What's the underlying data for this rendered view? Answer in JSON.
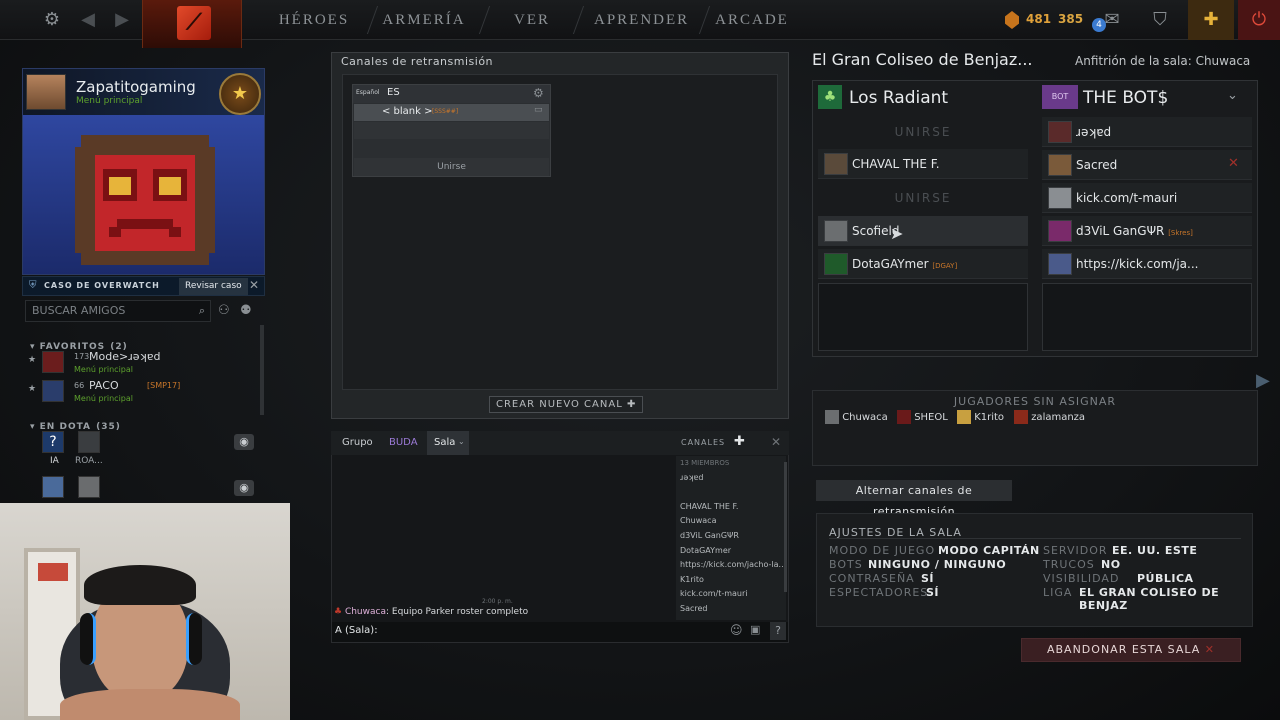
{
  "topbar": {
    "nav": [
      "HÉROES",
      "ARMERÍA",
      "VER",
      "APRENDER",
      "ARCADE"
    ],
    "currency_shards": "481",
    "currency_level": "385",
    "notifications": "4"
  },
  "profile": {
    "name": "Zapatitogaming",
    "status": "Menú principal"
  },
  "overwatch": {
    "label": "CASO DE OVERWATCH",
    "button": "Revisar caso"
  },
  "friends": {
    "search_placeholder": "BUSCAR AMIGOS",
    "favorites_header": "FAVORITOS",
    "favorites_count": "(2)",
    "favorites": [
      {
        "level": "173",
        "name": "Mode>ɹǝʞɐd",
        "tag": "",
        "status": "Menú principal"
      },
      {
        "level": "66",
        "name": "PACO",
        "tag": "[SMP17]",
        "status": "Menú principal"
      }
    ],
    "in_dota_header": "EN DOTA",
    "in_dota_count": "(35)",
    "in_dota": [
      {
        "name": "IA"
      },
      {
        "name": "ROA..."
      }
    ]
  },
  "broadcast": {
    "title": "Canales de retransmisión",
    "lang_small": "Español",
    "lang_code": "ES",
    "channel": "< blank >",
    "channel_tag": "[SSS##]",
    "join": "Unirse",
    "new_channel": "CREAR NUEVO CANAL"
  },
  "chat": {
    "tabs": [
      "Grupo",
      "BUDA",
      "Sala"
    ],
    "channels_label": "CANALES",
    "members_count": "13 MIEMBROS",
    "members": [
      "ɹǝʞɐd",
      "",
      "CHAVAL THE F.",
      "Chuwaca",
      "d3ViL GanGΨR",
      "DotaGAYmer",
      "https://kick.com/jacho-la...",
      "K1rito",
      "kick.com/t-mauri",
      "Sacred"
    ],
    "time": "2:00 p. m.",
    "message_author": "Chuwaca",
    "message_text": ": Equipo Parker roster completo",
    "input_prefix": "A (Sala):"
  },
  "lobby": {
    "title": "El Gran Coliseo de Benjaz...",
    "host": "Anfitrión de la sala: Chuwaca",
    "radiant": {
      "name": "Los Radiant",
      "join_label": "UNIRSE",
      "players": [
        "CHAVAL THE F.",
        "Scofield",
        "DotaGAYmer"
      ],
      "player_tag": "[DGAY]"
    },
    "dire": {
      "name": "THE BOT$",
      "players": [
        "ɹǝʞɐd",
        "Sacred",
        "kick.com/t-mauri",
        "d3ViL GanGΨR",
        "https://kick.com/ja..."
      ],
      "devil_tag": "[Skres]"
    },
    "unassigned_header": "JUGADORES SIN ASIGNAR",
    "unassigned": [
      "Chuwaca",
      "SHEOL",
      "K1rito",
      "zalamanza"
    ],
    "toggle_broadcast": "Alternar canales de retransmisión",
    "settings": {
      "header": "AJUSTES DE LA SALA",
      "mode_label": "MODO DE JUEGO",
      "mode_value": "MODO CAPITÁN",
      "bots_label": "BOTS",
      "bots_value": "NINGUNO / NINGUNO",
      "password_label": "CONTRASEÑA",
      "password_value": "SÍ",
      "spectators_label": "ESPECTADORES",
      "spectators_value": "SÍ",
      "server_label": "SERVIDOR",
      "server_value": "EE. UU. ESTE",
      "cheats_label": "TRUCOS",
      "cheats_value": "NO",
      "visibility_label": "VISIBILIDAD",
      "visibility_value": "PÚBLICA",
      "league_label": "LIGA",
      "league_value": "EL GRAN COLISEO DE",
      "league_value2": "BENJAZ"
    },
    "leave": "ABANDONAR ESTA SALA"
  },
  "colors": {
    "accent_red": "#c0392b",
    "status_green": "#5da02d",
    "gold": "#f2c94c"
  }
}
